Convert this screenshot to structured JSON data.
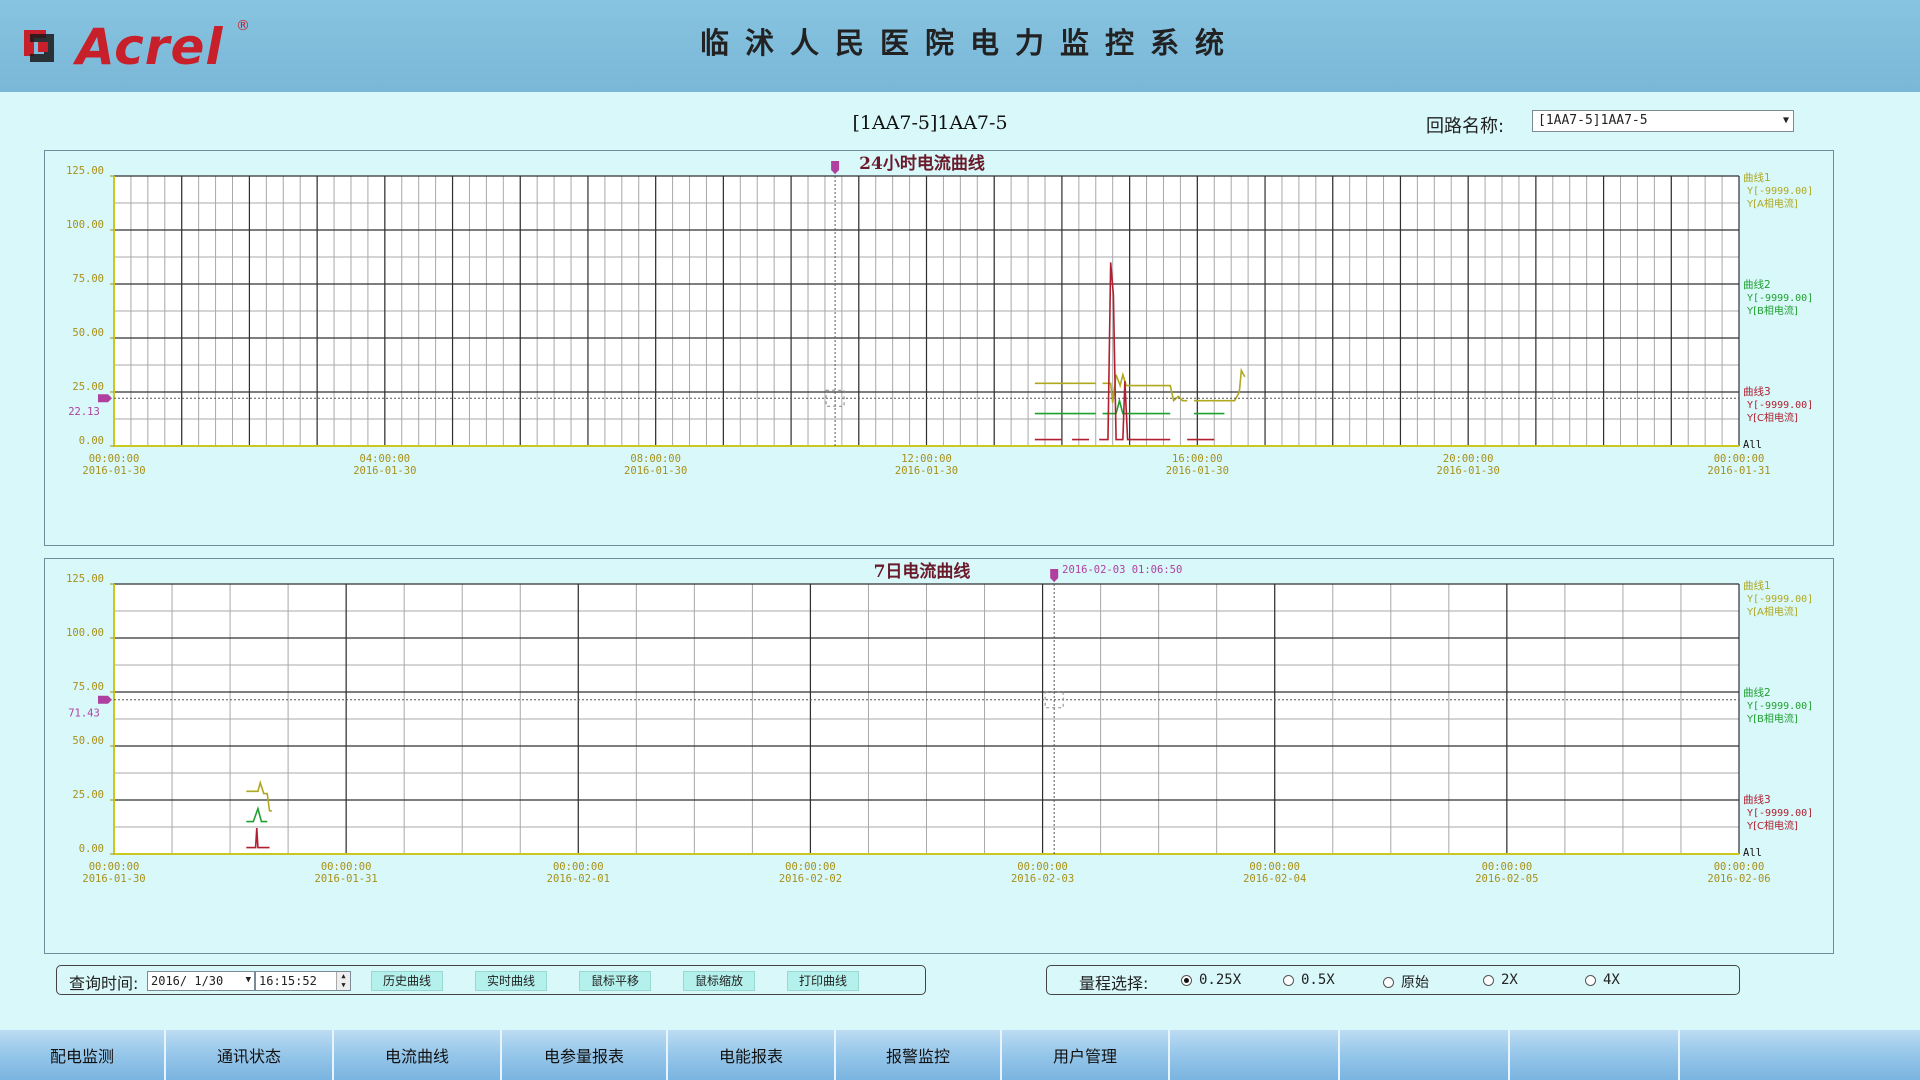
{
  "header": {
    "logo_text": "Acrel",
    "logo_reg": "®",
    "system_title": "临沭人民医院电力监控系统"
  },
  "circuit_heading": "[1AA7-5]1AA7-5",
  "loop_select": {
    "label": "回路名称:",
    "value": "[1AA7-5]1AA7-5"
  },
  "colors": {
    "curve_a": "#b0a820",
    "curve_b": "#20a030",
    "curve_c": "#b02030",
    "cursor": "#b040a0",
    "background": "#d8f8fa",
    "header": "#7ab7d8"
  },
  "chart_data": [
    {
      "type": "line",
      "title": "24小时电流曲线",
      "ylim": [
        0,
        125
      ],
      "ytick_labels": [
        "125.00",
        "100.00",
        "75.00",
        "50.00",
        "25.00",
        "0.00"
      ],
      "xtick_labels": [
        [
          "00:00:00",
          "2016-01-30"
        ],
        [
          "04:00:00",
          "2016-01-30"
        ],
        [
          "08:00:00",
          "2016-01-30"
        ],
        [
          "12:00:00",
          "2016-01-30"
        ],
        [
          "16:00:00",
          "2016-01-30"
        ],
        [
          "20:00:00",
          "2016-01-30"
        ],
        [
          "00:00:00",
          "2016-01-31"
        ]
      ],
      "x_range_hours": [
        0,
        24
      ],
      "cursor_value": "22.13",
      "cursor_y": 22.13,
      "cursor_x": 10.65,
      "all_label": "All",
      "legend": [
        {
          "name": "曲线1",
          "y": "Y[-9999.00]",
          "desc": "Y[A相电流]"
        },
        {
          "name": "曲线2",
          "y": "Y[-9999.00]",
          "desc": "Y[B相电流]"
        },
        {
          "name": "曲线3",
          "y": "Y[-9999.00]",
          "desc": "Y[C相电流]"
        }
      ],
      "series": [
        {
          "name": "A相电流",
          "segments": [
            [
              [
                13.6,
                29
              ],
              [
                14.5,
                29
              ]
            ],
            [
              [
                14.6,
                29
              ],
              [
                14.72,
                29
              ],
              [
                14.75,
                20
              ],
              [
                14.8,
                33
              ],
              [
                14.86,
                28
              ],
              [
                14.9,
                33
              ],
              [
                14.95,
                28
              ],
              [
                15.6,
                28
              ],
              [
                15.65,
                21
              ],
              [
                15.72,
                23
              ],
              [
                15.78,
                21
              ],
              [
                15.85,
                21
              ]
            ],
            [
              [
                15.95,
                21
              ],
              [
                16.55,
                21
              ],
              [
                16.62,
                25
              ],
              [
                16.65,
                35
              ],
              [
                16.7,
                32
              ]
            ]
          ]
        },
        {
          "name": "B相电流",
          "segments": [
            [
              [
                13.6,
                15
              ],
              [
                14.5,
                15
              ]
            ],
            [
              [
                14.6,
                15
              ],
              [
                14.8,
                15
              ],
              [
                14.85,
                21
              ],
              [
                14.9,
                15
              ],
              [
                15.6,
                15
              ]
            ],
            [
              [
                15.95,
                15
              ],
              [
                16.4,
                15
              ]
            ]
          ]
        },
        {
          "name": "C相电流",
          "segments": [
            [
              [
                13.6,
                3
              ],
              [
                14.0,
                3
              ]
            ],
            [
              [
                14.15,
                3
              ],
              [
                14.4,
                3
              ]
            ],
            [
              [
                14.55,
                3
              ],
              [
                14.68,
                3
              ],
              [
                14.72,
                85
              ],
              [
                14.76,
                70
              ],
              [
                14.8,
                3
              ],
              [
                14.9,
                3
              ],
              [
                14.93,
                30
              ],
              [
                14.97,
                3
              ],
              [
                15.6,
                3
              ]
            ],
            [
              [
                15.85,
                3
              ],
              [
                16.25,
                3
              ]
            ]
          ]
        }
      ]
    },
    {
      "type": "line",
      "title": "7日电流曲线",
      "ylim": [
        0,
        125
      ],
      "ytick_labels": [
        "125.00",
        "100.00",
        "75.00",
        "50.00",
        "25.00",
        "0.00"
      ],
      "xtick_labels": [
        [
          "00:00:00",
          "2016-01-30"
        ],
        [
          "00:00:00",
          "2016-01-31"
        ],
        [
          "00:00:00",
          "2016-02-01"
        ],
        [
          "00:00:00",
          "2016-02-02"
        ],
        [
          "00:00:00",
          "2016-02-03"
        ],
        [
          "00:00:00",
          "2016-02-04"
        ],
        [
          "00:00:00",
          "2016-02-05"
        ],
        [
          "00:00:00",
          "2016-02-06"
        ]
      ],
      "x_range_days": [
        0,
        7
      ],
      "cursor_value": "71.43",
      "cursor_y": 71.43,
      "cursor_x": 4.05,
      "cursor_time": "2016-02-03 01:06:50",
      "all_label": "All",
      "legend": [
        {
          "name": "曲线1",
          "y": "Y[-9999.00]",
          "desc": "Y[A相电流]"
        },
        {
          "name": "曲线2",
          "y": "Y[-9999.00]",
          "desc": "Y[B相电流]"
        },
        {
          "name": "曲线3",
          "y": "Y[-9999.00]",
          "desc": "Y[C相电流]"
        }
      ],
      "series": [
        {
          "name": "A相电流",
          "segments": [
            [
              [
                0.57,
                29
              ],
              [
                0.62,
                29
              ],
              [
                0.63,
                33
              ],
              [
                0.645,
                28
              ],
              [
                0.66,
                28
              ],
              [
                0.67,
                20
              ],
              [
                0.68,
                20
              ]
            ]
          ]
        },
        {
          "name": "B相电流",
          "segments": [
            [
              [
                0.57,
                15
              ],
              [
                0.6,
                15
              ],
              [
                0.62,
                21
              ],
              [
                0.635,
                15
              ],
              [
                0.66,
                15
              ]
            ]
          ]
        },
        {
          "name": "C相电流",
          "segments": [
            [
              [
                0.57,
                3
              ],
              [
                0.61,
                3
              ],
              [
                0.615,
                12
              ],
              [
                0.62,
                3
              ],
              [
                0.67,
                3
              ]
            ]
          ]
        }
      ]
    }
  ],
  "toolbar": {
    "query_label": "查询时间:",
    "date_value": "2016/ 1/30",
    "time_value": "16:15:52",
    "buttons": [
      "历史曲线",
      "实时曲线",
      "鼠标平移",
      "鼠标缩放",
      "打印曲线"
    ]
  },
  "range_select": {
    "label": "量程选择:",
    "options": [
      "0.25X",
      "0.5X",
      "原始",
      "2X",
      "4X"
    ],
    "selected": "0.25X"
  },
  "bottom_nav": [
    "配电监测",
    "通讯状态",
    "电流曲线",
    "电参量报表",
    "电能报表",
    "报警监控",
    "用户管理",
    "",
    "",
    "",
    ""
  ]
}
